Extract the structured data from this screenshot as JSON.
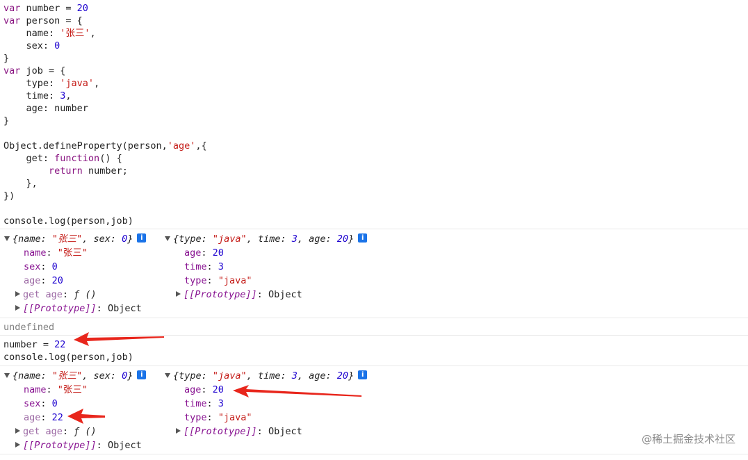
{
  "code": {
    "line1": {
      "kw": "var",
      "rest": " number = ",
      "num": "20"
    },
    "line2": {
      "kw": "var",
      "rest": " person = {"
    },
    "line3": {
      "text": "    name: ",
      "str": "'张三'",
      "tail": ","
    },
    "line4": {
      "text": "    sex: ",
      "num": "0"
    },
    "line5": {
      "text": "}"
    },
    "line6": {
      "kw": "var",
      "rest": " job = {"
    },
    "line7": {
      "text": "    type: ",
      "str": "'java'",
      "tail": ","
    },
    "line8": {
      "text": "    time: ",
      "num": "3",
      "tail": ","
    },
    "line9": {
      "text": "    age: number"
    },
    "line10": {
      "text": "}"
    },
    "line12": {
      "text": "Object.defineProperty(person,",
      "str": "'age'",
      "tail": ",{"
    },
    "line13": {
      "text": "    get: ",
      "kw": "function",
      "tail": "() {"
    },
    "line14": {
      "text": "        ",
      "kw": "return",
      "tail": " number;"
    },
    "line15": {
      "text": "    },"
    },
    "line16": {
      "text": "})"
    },
    "line18": {
      "text": "console.log(person,job)"
    }
  },
  "output1": {
    "person_summary": {
      "open": "{",
      "k1": "name: ",
      "v1": "\"张三\"",
      "c1": ", ",
      "k2": "sex: ",
      "v2": "0",
      "close": "}"
    },
    "person_props": [
      {
        "key": "name",
        "value": "\"张三\""
      },
      {
        "key": "sex",
        "value": "0"
      },
      {
        "key": "age",
        "value": "20"
      }
    ],
    "person_getter": {
      "label": "get age",
      "value": "ƒ ()"
    },
    "proto_label": "[[Prototype]]",
    "proto_value": "Object",
    "job_summary": {
      "open": "{",
      "k1": "type: ",
      "v1": "\"java\"",
      "c1": ", ",
      "k2": "time: ",
      "v2": "3",
      "c2": ", ",
      "k3": "age: ",
      "v3": "20",
      "close": "}"
    },
    "job_props": [
      {
        "key": "age",
        "value": "20"
      },
      {
        "key": "time",
        "value": "3"
      },
      {
        "key": "type",
        "value": "\"java\""
      }
    ]
  },
  "undefined_text": "undefined",
  "cmd": {
    "assign_text": "number = ",
    "assign_num": "22",
    "log": "console.log(person,job)"
  },
  "output2": {
    "person_summary": {
      "open": "{",
      "k1": "name: ",
      "v1": "\"张三\"",
      "c1": ", ",
      "k2": "sex: ",
      "v2": "0",
      "close": "}"
    },
    "person_props": [
      {
        "key": "name",
        "value": "\"张三\""
      },
      {
        "key": "sex",
        "value": "0"
      },
      {
        "key": "age",
        "value": "22"
      }
    ],
    "person_getter": {
      "label": "get age",
      "value": "ƒ ()"
    },
    "proto_label": "[[Prototype]]",
    "proto_value": "Object",
    "job_summary": {
      "open": "{",
      "k1": "type: ",
      "v1": "\"java\"",
      "c1": ", ",
      "k2": "time: ",
      "v2": "3",
      "c2": ", ",
      "k3": "age: ",
      "v3": "20",
      "close": "}"
    },
    "job_props": [
      {
        "key": "age",
        "value": "20"
      },
      {
        "key": "time",
        "value": "3"
      },
      {
        "key": "type",
        "value": "\"java\""
      }
    ]
  },
  "info_glyph": "i",
  "watermark": "@稀土掘金技术社区",
  "colors": {
    "arrow": "#e8261c",
    "keyword": "#881280",
    "string": "#c41a16",
    "number": "#1c00cf",
    "info": "#1a73e8"
  }
}
